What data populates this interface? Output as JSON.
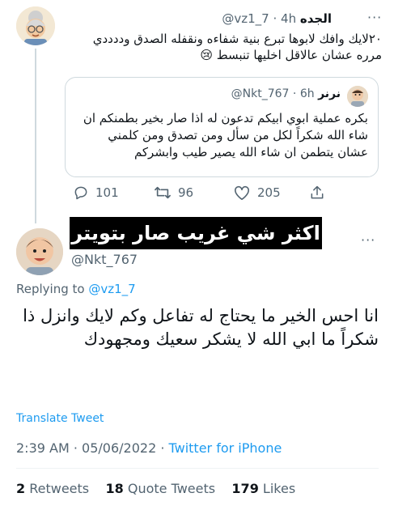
{
  "original_tweet": {
    "display_name": "الجده",
    "handle": "@vz1_7",
    "time": "4h",
    "text": "٢٠لايك وافك لابوها تبرع بنية شفاءه ونقفله الصدق وددددي مرره عشان عالاقل اخليها تنبسط 😢",
    "quoted": {
      "display_name": "نرنر",
      "handle": "@Nkt_767",
      "time": "6h",
      "text": "بكره عملية ابوي ابيكم تدعون له اذا صار بخير بطمنكم ان شاء الله شكراً لكل من سأل ومن تصدق ومن كلمني عشان يتطمن ان شاء الله يصير طيب وابشركم"
    },
    "actions": {
      "replies": "101",
      "retweets": "96",
      "likes": "205"
    }
  },
  "overlay_banner": "اكثر شي غريب صار بتويتر",
  "reply_tweet": {
    "handle": "@Nkt_767",
    "replying_prefix": "Replying to",
    "replying_to": "@vz1_7",
    "text": "انا احس الخير ما يحتاج له تفاعل وكم لايك وانزل ذا شكراً ما ابي الله لا يشكر سعيك ومجهودك",
    "translate_label": "Translate Tweet",
    "timestamp": "2:39 AM · 05/06/2022 · ",
    "source": "Twitter for iPhone",
    "stats": {
      "retweets_count": "2",
      "retweets_label": "Retweets",
      "quotes_count": "18",
      "quotes_label": "Quote Tweets",
      "likes_count": "179",
      "likes_label": "Likes"
    }
  },
  "colors": {
    "accent": "#1d9bf0",
    "secondary_text": "#536471"
  }
}
